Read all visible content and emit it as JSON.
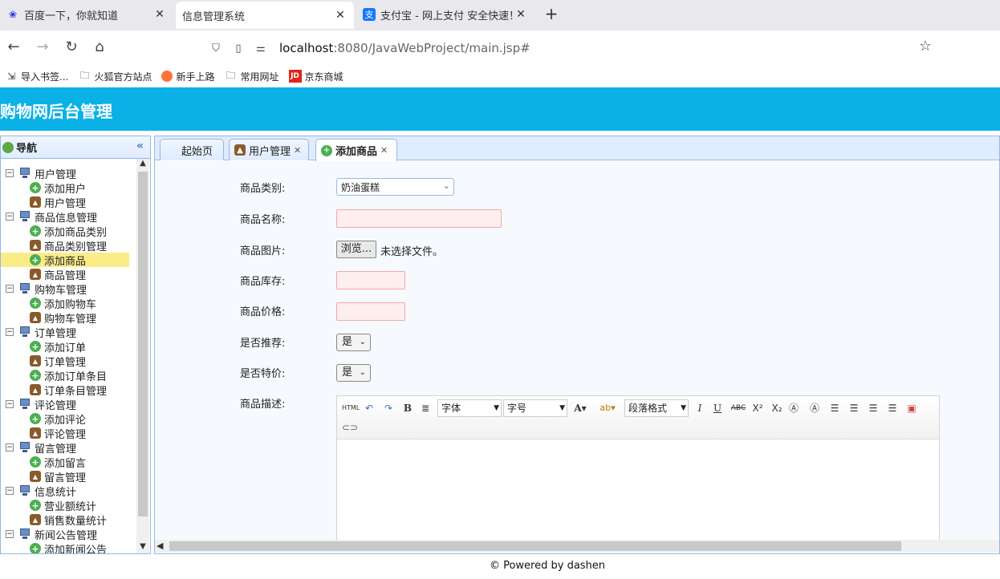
{
  "browser": {
    "tabs": [
      {
        "icon": "paw-icon",
        "title": "百度一下，你就知道"
      },
      {
        "icon": "",
        "title": "信息管理系统"
      },
      {
        "icon": "alipay-icon",
        "title": "支付宝 - 网上支付 安全快速！"
      }
    ],
    "new_tab": "+",
    "url_host": "localhost",
    "url_path": ":8080/JavaWebProject/main.jsp#",
    "bookmarks": [
      {
        "icon": "import-icon",
        "label": "导入书签..."
      },
      {
        "icon": "folder-icon",
        "label": "火狐官方站点"
      },
      {
        "icon": "firefox-icon",
        "label": "新手上路"
      },
      {
        "icon": "folder-icon",
        "label": "常用网址"
      },
      {
        "icon": "jd-icon",
        "label": "京东商城"
      }
    ]
  },
  "app": {
    "title": "购物网后台管理",
    "nav_title": "导航",
    "tree": [
      {
        "type": "group",
        "label": "用户管理"
      },
      {
        "type": "add",
        "label": "添加用户"
      },
      {
        "type": "user",
        "label": "用户管理"
      },
      {
        "type": "group",
        "label": "商品信息管理"
      },
      {
        "type": "add",
        "label": "添加商品类别"
      },
      {
        "type": "user",
        "label": "商品类别管理"
      },
      {
        "type": "add",
        "label": "添加商品",
        "selected": true
      },
      {
        "type": "user",
        "label": "商品管理"
      },
      {
        "type": "group",
        "label": "购物车管理"
      },
      {
        "type": "add",
        "label": "添加购物车"
      },
      {
        "type": "user",
        "label": "购物车管理"
      },
      {
        "type": "group",
        "label": "订单管理"
      },
      {
        "type": "add",
        "label": "添加订单"
      },
      {
        "type": "user",
        "label": "订单管理"
      },
      {
        "type": "add",
        "label": "添加订单条目"
      },
      {
        "type": "user",
        "label": "订单条目管理"
      },
      {
        "type": "group",
        "label": "评论管理"
      },
      {
        "type": "add",
        "label": "添加评论"
      },
      {
        "type": "user",
        "label": "评论管理"
      },
      {
        "type": "group",
        "label": "留言管理"
      },
      {
        "type": "add",
        "label": "添加留言"
      },
      {
        "type": "user",
        "label": "留言管理"
      },
      {
        "type": "group",
        "label": "信息统计"
      },
      {
        "type": "add",
        "label": "营业额统计"
      },
      {
        "type": "user",
        "label": "销售数量统计"
      },
      {
        "type": "group",
        "label": "新闻公告管理"
      },
      {
        "type": "add",
        "label": "添加新闻公告"
      }
    ],
    "tabs": [
      {
        "label": "起始页",
        "closable": false
      },
      {
        "label": "用户管理",
        "closable": true
      },
      {
        "label": "添加商品",
        "closable": true,
        "active": true
      }
    ],
    "form": {
      "category_label": "商品类别:",
      "category_value": "奶油蛋糕",
      "name_label": "商品名称:",
      "image_label": "商品图片:",
      "browse_button": "浏览...",
      "no_file": "未选择文件。",
      "stock_label": "商品库存:",
      "price_label": "商品价格:",
      "recommend_label": "是否推荐:",
      "recommend_value": "是",
      "special_label": "是否特价:",
      "special_value": "是",
      "desc_label": "商品描述:"
    },
    "editor": {
      "html": "HTML",
      "bold": "B",
      "font": "字体",
      "size": "字号",
      "fontcolor": "A",
      "paragraph": "段落格式",
      "italic": "I",
      "underline": "U",
      "strike": "ABC",
      "sup": "X²",
      "sub": "X₂"
    },
    "footer": "© Powered by dashen"
  }
}
